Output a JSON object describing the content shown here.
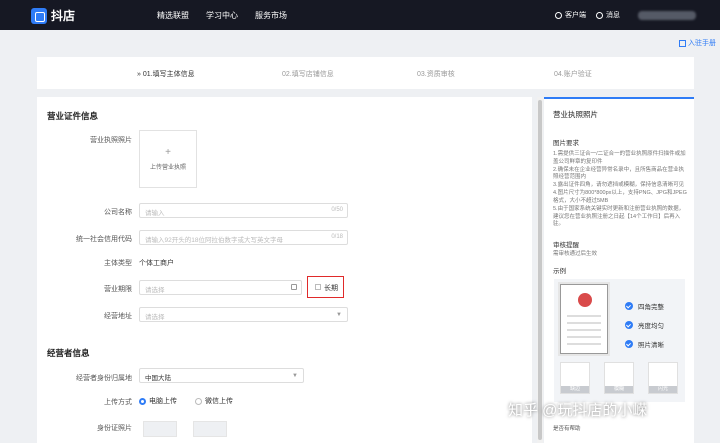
{
  "app": {
    "name": "抖店"
  },
  "nav": [
    "精选联盟",
    "学习中心",
    "服务市场"
  ],
  "topright": {
    "client": "客户端",
    "messages": "消息"
  },
  "entry_link": "入驻手册",
  "steps": [
    {
      "label": "01.填写主体信息"
    },
    {
      "label": "02.填写店铺信息"
    },
    {
      "label": "03.资质审核"
    },
    {
      "label": "04.账户验证"
    }
  ],
  "business": {
    "title": "营业证件信息",
    "license_label": "营业执照照片",
    "upload_text": "上传营业执照",
    "company_label": "公司名称",
    "company_placeholder": "请输入",
    "company_count": "0/50",
    "credit_label": "统一社会信用代码",
    "credit_placeholder": "请输入92开头的18位阿拉伯数字或大写英文字母",
    "credit_count": "0/18",
    "type_label": "主体类型",
    "type_value": "个体工商户",
    "period_label": "营业期限",
    "period_placeholder": "请选择",
    "longterm": "长期",
    "address_label": "经营地址",
    "address_placeholder": "请选择"
  },
  "operator": {
    "title": "经营者信息",
    "region_label": "经营者身份归属地",
    "region_value": "中国大陆",
    "upload_method_label": "上传方式",
    "upload_pc": "电脑上传",
    "upload_wechat": "微信上传",
    "id_photo_label": "身份证照片"
  },
  "side": {
    "title": "营业执照照片",
    "req_title": "图片要求",
    "requirements": [
      "1.需提供三证合一/二证合一的营业执照原件扫描件或加盖公司鲜章的复印件",
      "2.确保未在企业经营异常名录中，且所售商品在营业执照经营范围内",
      "3.露出证件四角，请勿遮挡或模糊，保持信息清晰可见",
      "4.图片尺寸为800*800px以上，支持PNG、JPG和JPEG格式，大小不超过5MB",
      "5.由于国家系统关键实时更新和注册营业执照的数据，建议您在营业执照注册之日起【14个工作日】后再入驻。"
    ],
    "audit_title": "审核提醒",
    "audit_note": "需审核通过后生效",
    "example_title": "示例",
    "checks": [
      "四角完整",
      "亮度均匀",
      "照片清晰"
    ],
    "bad_labels": [
      "缺边",
      "模糊",
      "闪光"
    ],
    "footer": "是否有帮助"
  },
  "watermark": "知乎 @玩抖店的小嵘"
}
